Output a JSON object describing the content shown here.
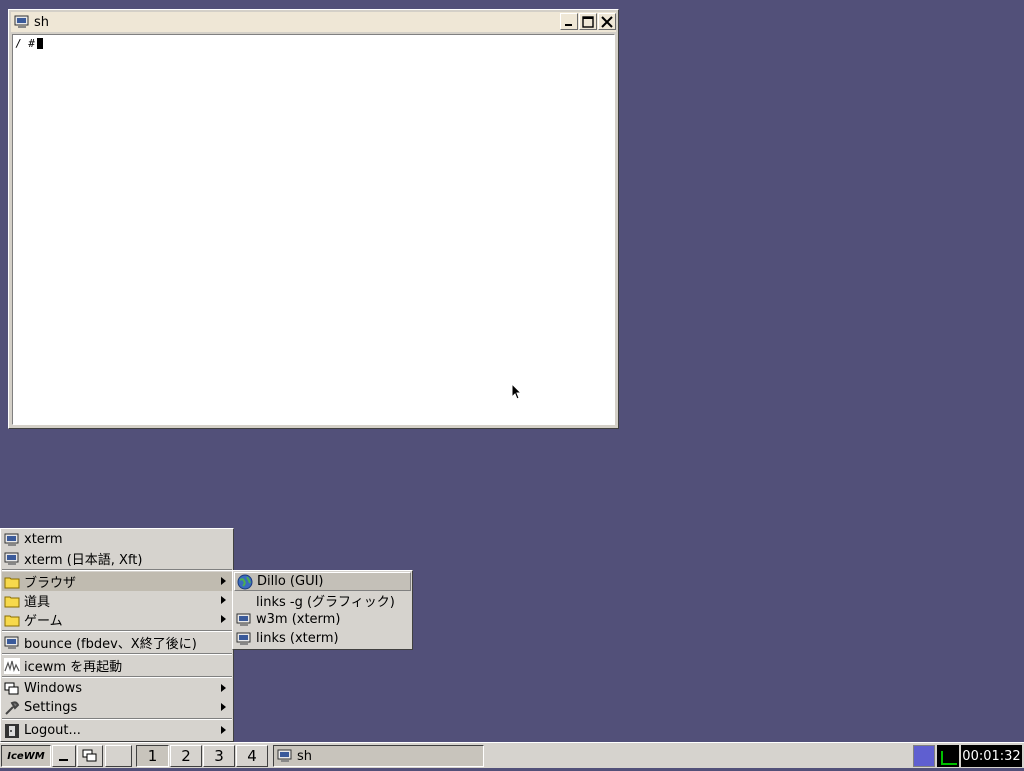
{
  "window": {
    "title": "sh",
    "prompt": "/ #"
  },
  "start_menu": {
    "items": [
      {
        "label": "xterm",
        "icon": "terminal-icon"
      },
      {
        "label": "xterm (日本語, Xft)",
        "icon": "terminal-icon"
      },
      {
        "label": "ブラウザ",
        "icon": "folder-icon",
        "submenu": true
      },
      {
        "label": "道具",
        "icon": "folder-icon",
        "submenu": true
      },
      {
        "label": "ゲーム",
        "icon": "folder-icon",
        "submenu": true
      },
      {
        "label": "bounce (fbdev、X終了後に)",
        "icon": "terminal-icon"
      },
      {
        "label": "icewm を再起動",
        "icon": "restart-icon"
      },
      {
        "label": "Windows",
        "icon": "windows-icon",
        "submenu": true
      },
      {
        "label": "Settings",
        "icon": "settings-icon",
        "submenu": true
      },
      {
        "label": "Logout...",
        "icon": "logout-icon",
        "submenu": true
      }
    ]
  },
  "browser_submenu": {
    "items": [
      {
        "label": "Dillo (GUI)",
        "icon": "globe-icon"
      },
      {
        "label": "links -g (グラフィック)",
        "icon": ""
      },
      {
        "label": "w3m (xterm)",
        "icon": "terminal-icon"
      },
      {
        "label": "links (xterm)",
        "icon": "terminal-icon"
      }
    ]
  },
  "taskbar": {
    "start_label": "IceWM",
    "workspaces": [
      "1",
      "2",
      "3",
      "4"
    ],
    "active_workspace": "1",
    "task_label": "sh",
    "clock": "00:01:32"
  },
  "colors": {
    "desktop": "#525079",
    "menu": "#d6d3ce",
    "highlight": "#c0bbb0"
  }
}
